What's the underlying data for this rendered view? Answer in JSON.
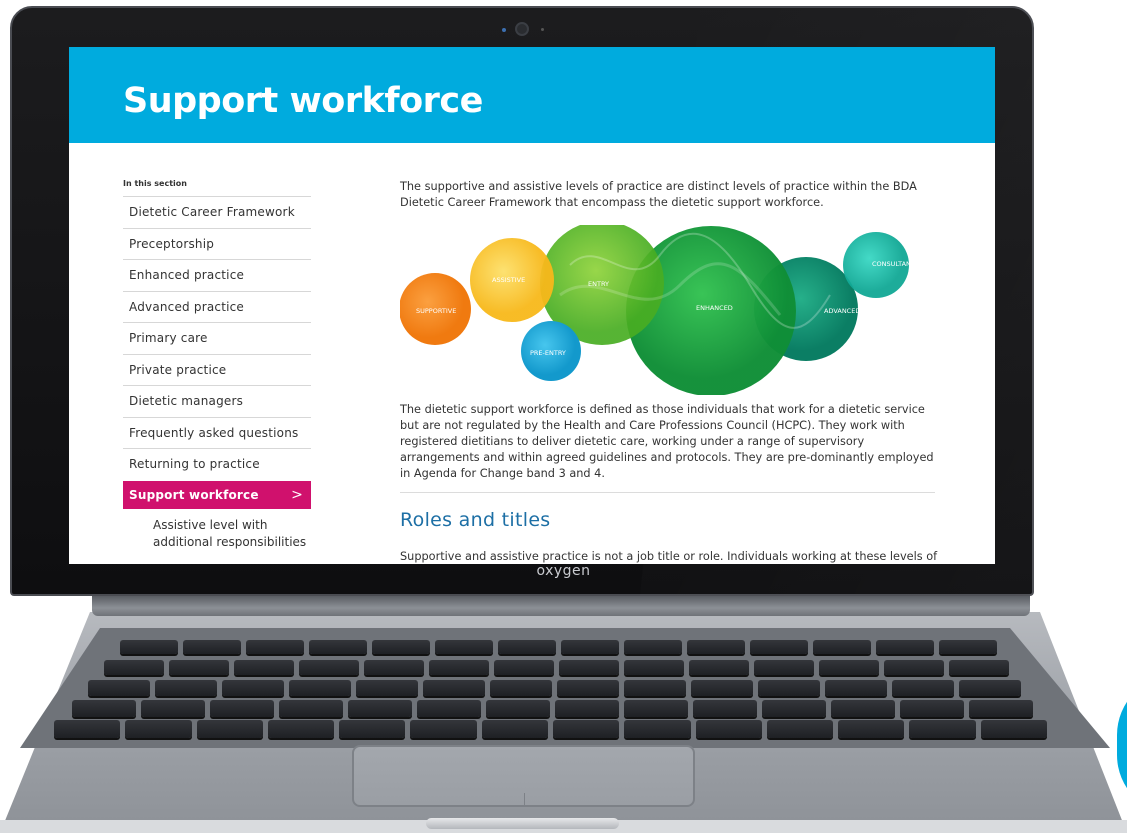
{
  "page": {
    "title": "Support workforce"
  },
  "device": {
    "brand": "oxygen"
  },
  "sidebar": {
    "section_label": "In this section",
    "items": [
      {
        "label": "Dietetic Career Framework"
      },
      {
        "label": "Preceptorship"
      },
      {
        "label": "Enhanced practice"
      },
      {
        "label": "Advanced practice"
      },
      {
        "label": "Primary care"
      },
      {
        "label": "Private practice"
      },
      {
        "label": "Dietetic managers"
      },
      {
        "label": "Frequently asked questions"
      },
      {
        "label": "Returning to practice"
      }
    ],
    "active_item": {
      "label": "Support workforce",
      "chevron": ">"
    },
    "sub_item": {
      "label": "Assistive level with additional responsibilities"
    }
  },
  "main": {
    "intro_paragraph": "The supportive and assistive levels of practice are distinct levels of practice within the BDA Dietetic Career Framework that encompass the dietetic support workforce.",
    "diagram_labels": {
      "supportive": "SUPPORTIVE",
      "assistive": "ASSISTIVE",
      "entry": "ENTRY",
      "pre_entry": "PRE-ENTRY",
      "enhanced": "ENHANCED",
      "advanced": "ADVANCED",
      "consultant": "CONSULTANT"
    },
    "definition_paragraph": "The dietetic support workforce is defined as those individuals that work for a dietetic service but are not regulated by the Health and Care Professions Council (HCPC). They work with registered dietitians to deliver dietetic care, working under a range of supervisory arrangements and within agreed guidelines and protocols. They are pre-dominantly employed in Agenda for Change band 3 and 4.",
    "section_heading": "Roles and titles",
    "roles_paragraph": "Supportive and assistive practice is not a job title or role. Individuals working at these levels of"
  },
  "colors": {
    "hero": "#00abde",
    "active_nav": "#d0116d",
    "heading": "#1d6fa5",
    "supportive": "#f58220",
    "assistive": "#fbc02d",
    "entry": "#5dbb2a",
    "pre_entry": "#1fa8d8",
    "enhanced": "#17a23a",
    "advanced": "#0f9a7a",
    "consultant": "#15b8a6"
  }
}
